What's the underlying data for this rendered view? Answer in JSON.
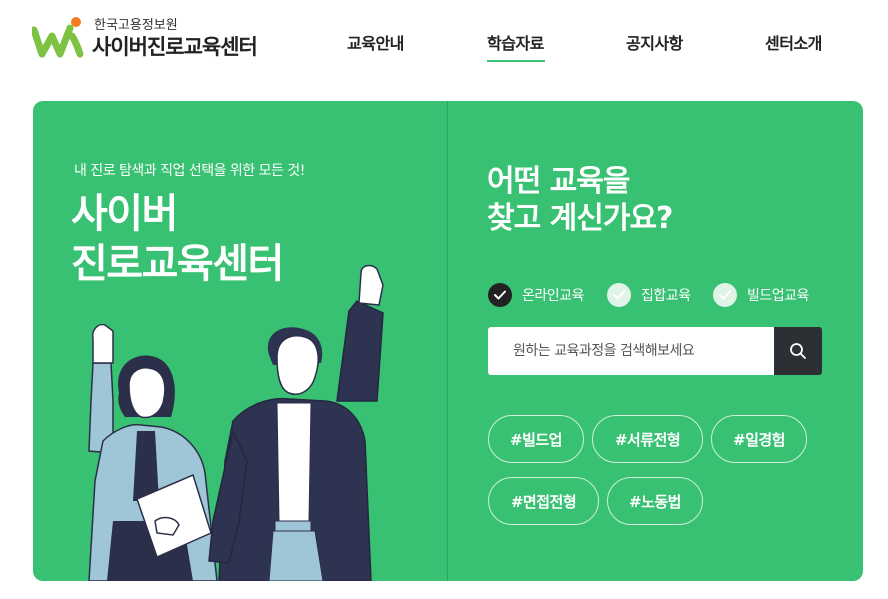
{
  "brand": {
    "org": "한국고용정보원",
    "name": "사이버진로교육센터",
    "colors": {
      "accent": "#38c172",
      "logo_green": "#7dc242",
      "logo_orange": "#f47b20",
      "dark": "#2c2f34"
    }
  },
  "nav": {
    "items": [
      {
        "label": "교육안내"
      },
      {
        "label": "학습자료",
        "active": true
      },
      {
        "label": "공지사항"
      },
      {
        "label": "센터소개"
      }
    ]
  },
  "hero": {
    "tagline": "내 진로 탐색과 직업 선택을 위한 모든 것!",
    "title_line1": "사이버",
    "title_line2": "진로교육센터",
    "question_line1": "어떤 교육을",
    "question_line2": "찾고 계신가요?",
    "filters": [
      {
        "label": "온라인교육",
        "checked": true
      },
      {
        "label": "집합교육",
        "checked": false
      },
      {
        "label": "빌드업교육",
        "checked": false
      }
    ],
    "search": {
      "placeholder": "원하는 교육과정을 검색해보세요",
      "button_icon": "search-icon"
    },
    "tags": [
      "#빌드업",
      "#서류전형",
      "#일경험",
      "#면접전형",
      "#노동법"
    ]
  }
}
